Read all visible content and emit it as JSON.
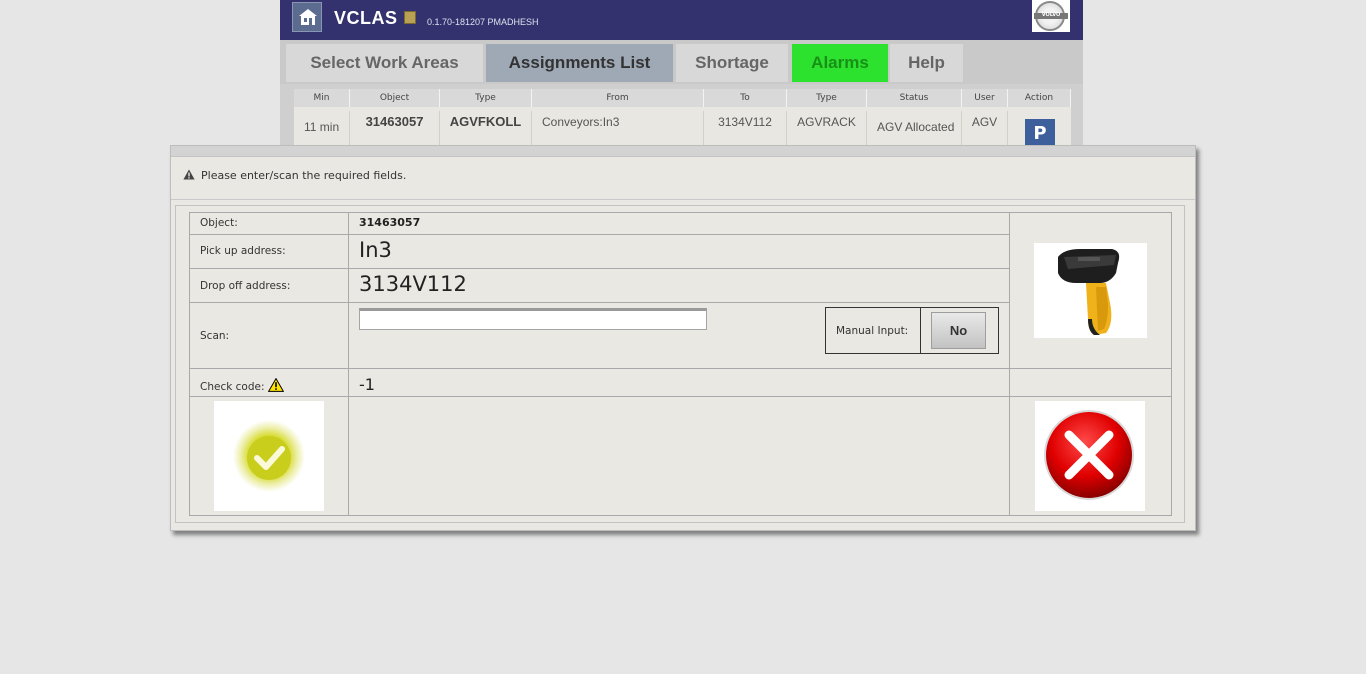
{
  "app": {
    "name": "VCLAS",
    "version": "0.1.70-181207 PMADHESH",
    "logo_text": "VOLVO"
  },
  "nav": {
    "tabs": [
      {
        "label": "Select Work Areas"
      },
      {
        "label": "Assignments List"
      },
      {
        "label": "Shortage"
      },
      {
        "label": "Alarms"
      },
      {
        "label": "Help"
      }
    ],
    "active_tab": "Assignments List",
    "alarm_color": "#2de22e"
  },
  "table": {
    "headers": [
      "Min",
      "Object",
      "Type",
      "From",
      "To",
      "Type",
      "Status",
      "User",
      "Action"
    ],
    "row": {
      "min": "11 min",
      "object": "31463057",
      "type": "AGVFKOLL",
      "from": "Conveyors:In3",
      "to": "3134V112",
      "type2": "AGVRACK",
      "status": "AGV Allocated",
      "user": "AGV",
      "action": "P"
    }
  },
  "dialog": {
    "message": "Please enter/scan the required fields.",
    "fields": {
      "object_label": "Object:",
      "object_value": "31463057",
      "pickup_label": "Pick up address:",
      "pickup_value": "In3",
      "dropoff_label": "Drop off address:",
      "dropoff_value": "3134V112",
      "scan_label": "Scan:",
      "scan_value": "",
      "manual_input_label": "Manual Input:",
      "manual_input_value": "No",
      "check_code_label": "Check code:",
      "check_code_value": "-1"
    },
    "icons": {
      "scanner": "barcode-scanner-icon",
      "confirm": "check-icon",
      "cancel": "cancel-x-icon",
      "warning": "warning-icon"
    }
  }
}
